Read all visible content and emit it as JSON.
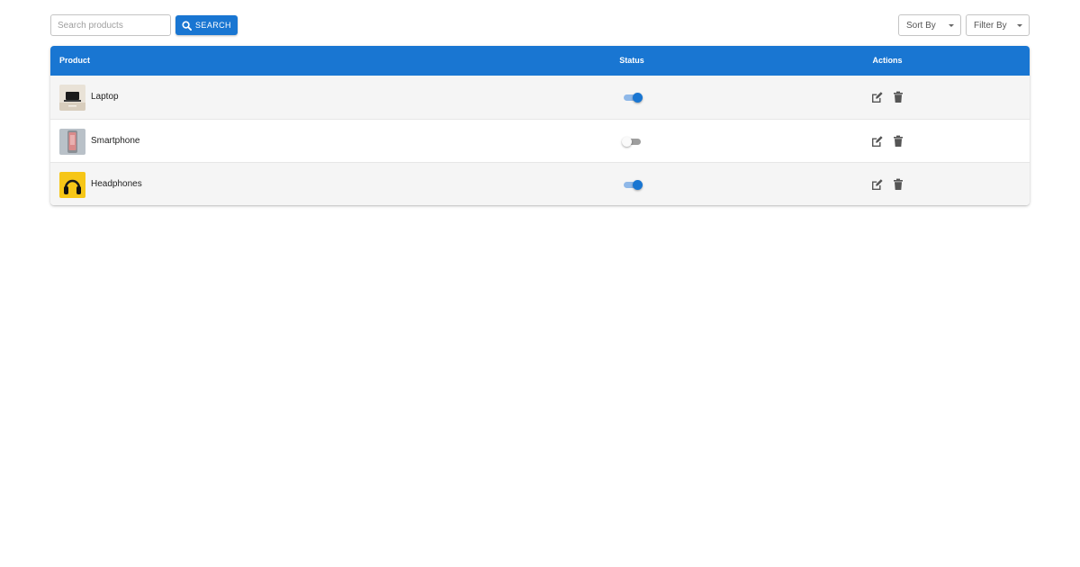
{
  "search": {
    "placeholder": "Search products",
    "value": "",
    "button_label": "SEARCH"
  },
  "controls": {
    "sort_label": "Sort By",
    "filter_label": "Filter By"
  },
  "table": {
    "headers": {
      "product": "Product",
      "status": "Status",
      "actions": "Actions"
    },
    "rows": [
      {
        "name": "Laptop",
        "status_on": true,
        "thumb_icon": "laptop-thumbnail"
      },
      {
        "name": "Smartphone",
        "status_on": false,
        "thumb_icon": "smartphone-thumbnail"
      },
      {
        "name": "Headphones",
        "status_on": true,
        "thumb_icon": "headphones-thumbnail"
      }
    ]
  },
  "colors": {
    "accent": "#1976d2",
    "header_text": "#ffffff",
    "row_alt": "#f5f5f5",
    "icon": "#555555"
  }
}
